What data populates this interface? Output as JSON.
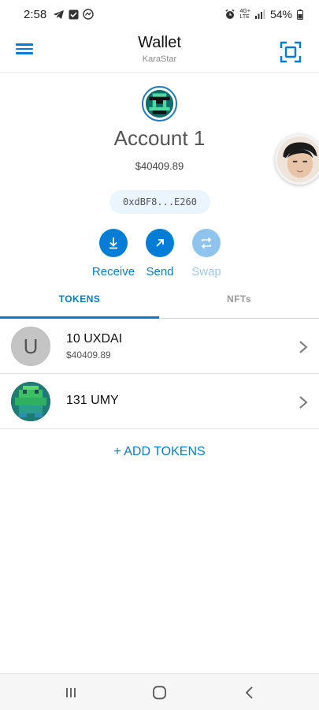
{
  "status_bar": {
    "time": "2:58",
    "network_top": "4G+",
    "network_bottom": "LTE",
    "battery": "54%",
    "icons": [
      "telegram-icon",
      "check-square-icon",
      "messenger-icon",
      "alarm-icon",
      "signal-icon",
      "battery-icon"
    ]
  },
  "header": {
    "title": "Wallet",
    "network": "KaraStar",
    "menu_icon": "hamburger-icon",
    "scan_icon": "qr-scan-icon"
  },
  "account": {
    "name": "Account 1",
    "balance": "$40409.89",
    "address": "0xdBF8...E260"
  },
  "actions": [
    {
      "label": "Receive",
      "icon": "arrow-down-icon",
      "enabled": true
    },
    {
      "label": "Send",
      "icon": "arrow-up-right-icon",
      "enabled": true
    },
    {
      "label": "Swap",
      "icon": "swap-icon",
      "enabled": false
    }
  ],
  "tabs": [
    {
      "label": "TOKENS",
      "active": true
    },
    {
      "label": "NFTs",
      "active": false
    }
  ],
  "tokens": [
    {
      "amount": "10 UXDAI",
      "fiat": "$40409.89",
      "icon_letter": "U"
    },
    {
      "amount": "131 UMY",
      "fiat": ""
    }
  ],
  "add_tokens_label": "+ ADD TOKENS",
  "colors": {
    "accent": "#037dd6",
    "accent_disabled": "#8fc4ee",
    "address_pill": "#eaf5ff",
    "identicon_bg": "#0e6e6a"
  },
  "nav_bar": {
    "icons": [
      "recent-apps-icon",
      "home-icon",
      "back-icon"
    ]
  }
}
